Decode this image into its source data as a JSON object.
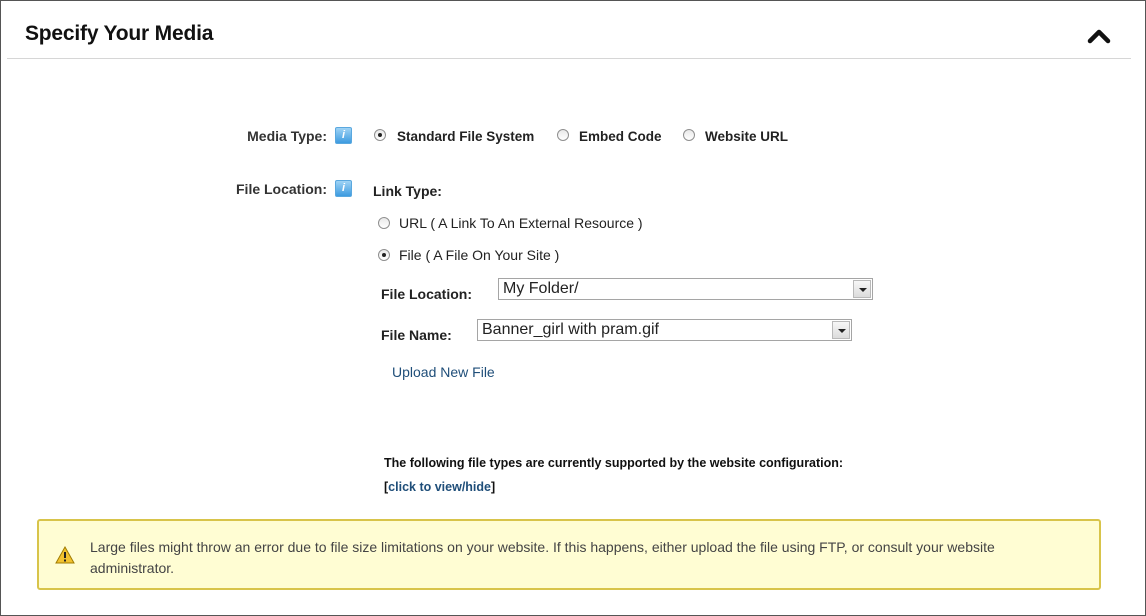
{
  "header": {
    "title": "Specify Your Media"
  },
  "media_type": {
    "label": "Media Type:",
    "options": [
      {
        "label": "Standard File System",
        "selected": true
      },
      {
        "label": "Embed Code",
        "selected": false
      },
      {
        "label": "Website URL",
        "selected": false
      }
    ]
  },
  "file_location": {
    "label": "File Location:",
    "link_type_label": "Link Type:",
    "link_options": [
      {
        "label": "URL ( A Link To An External Resource )",
        "selected": false
      },
      {
        "label": "File ( A File On Your Site )",
        "selected": true
      }
    ],
    "folder_label": "File Location:",
    "folder_value": "My Folder/",
    "file_name_label": "File Name:",
    "file_name_value": "Banner_girl with pram.gif",
    "upload_link": "Upload New File"
  },
  "file_types": {
    "notice": "The following file types are currently supported by the website configuration:",
    "open_bracket": "[",
    "toggle_link": "click to view/hide",
    "close_bracket": "]"
  },
  "warning": {
    "text": "Large files might throw an error due to file size limitations on your website. If this happens, either upload the file using FTP, or consult your website administrator."
  },
  "icons": {
    "collapse": "chevron-up-icon",
    "help": "help-icon",
    "warning": "warning-icon"
  },
  "help_glyph": "i",
  "colors": {
    "link": "#1f4e79",
    "warning_background": "#fffdd3",
    "warning_border": "#d8c44a",
    "help_icon": "#3d9be0"
  }
}
